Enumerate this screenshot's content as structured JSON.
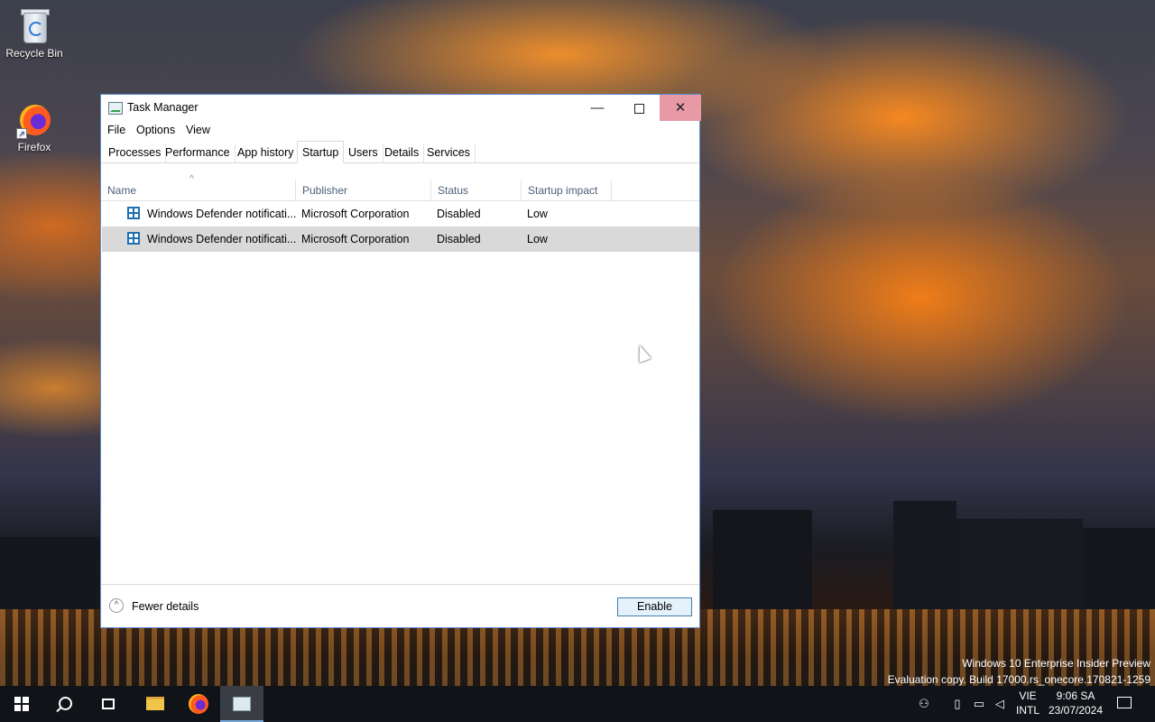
{
  "desktop": {
    "icons": [
      {
        "label": "Recycle Bin",
        "icon": "recycle-bin-icon"
      },
      {
        "label": "Firefox",
        "icon": "firefox-icon"
      }
    ],
    "watermark": {
      "line1": "Windows 10 Enterprise Insider Preview",
      "line2": "Evaluation copy. Build 17000.rs_onecore.170821-1259"
    }
  },
  "window": {
    "title": "Task Manager",
    "controls": {
      "minimize": "—",
      "close": "✕"
    },
    "menu": [
      "File",
      "Options",
      "View"
    ],
    "tabs": [
      "Processes",
      "Performance",
      "App history",
      "Startup",
      "Users",
      "Details",
      "Services"
    ],
    "active_tab": "Startup",
    "columns": {
      "name": "Name",
      "publisher": "Publisher",
      "status": "Status",
      "impact": "Startup impact"
    },
    "sort_indicator": "^",
    "rows": [
      {
        "name": "Windows Defender notificati...",
        "publisher": "Microsoft Corporation",
        "status": "Disabled",
        "impact": "Low",
        "selected": false
      },
      {
        "name": "Windows Defender notificati...",
        "publisher": "Microsoft Corporation",
        "status": "Disabled",
        "impact": "Low",
        "selected": true
      }
    ],
    "footer": {
      "fewer_details": "Fewer details",
      "enable_button": "Enable",
      "fewer_glyph": "^"
    }
  },
  "taskbar": {
    "buttons": [
      "start-icon",
      "search-icon",
      "task-view-icon",
      "file-explorer-icon",
      "firefox-icon",
      "task-manager-icon"
    ],
    "active_app": "task-manager",
    "language": {
      "top": "VIE",
      "bottom": "INTL"
    },
    "clock": {
      "time": "9:06 SA",
      "date": "23/07/2024"
    }
  },
  "colors": {
    "accent": "#3c7fb1",
    "close_hover": "#e79aa6",
    "selected_row": "#d9d9d9",
    "taskbar": "#101318"
  }
}
